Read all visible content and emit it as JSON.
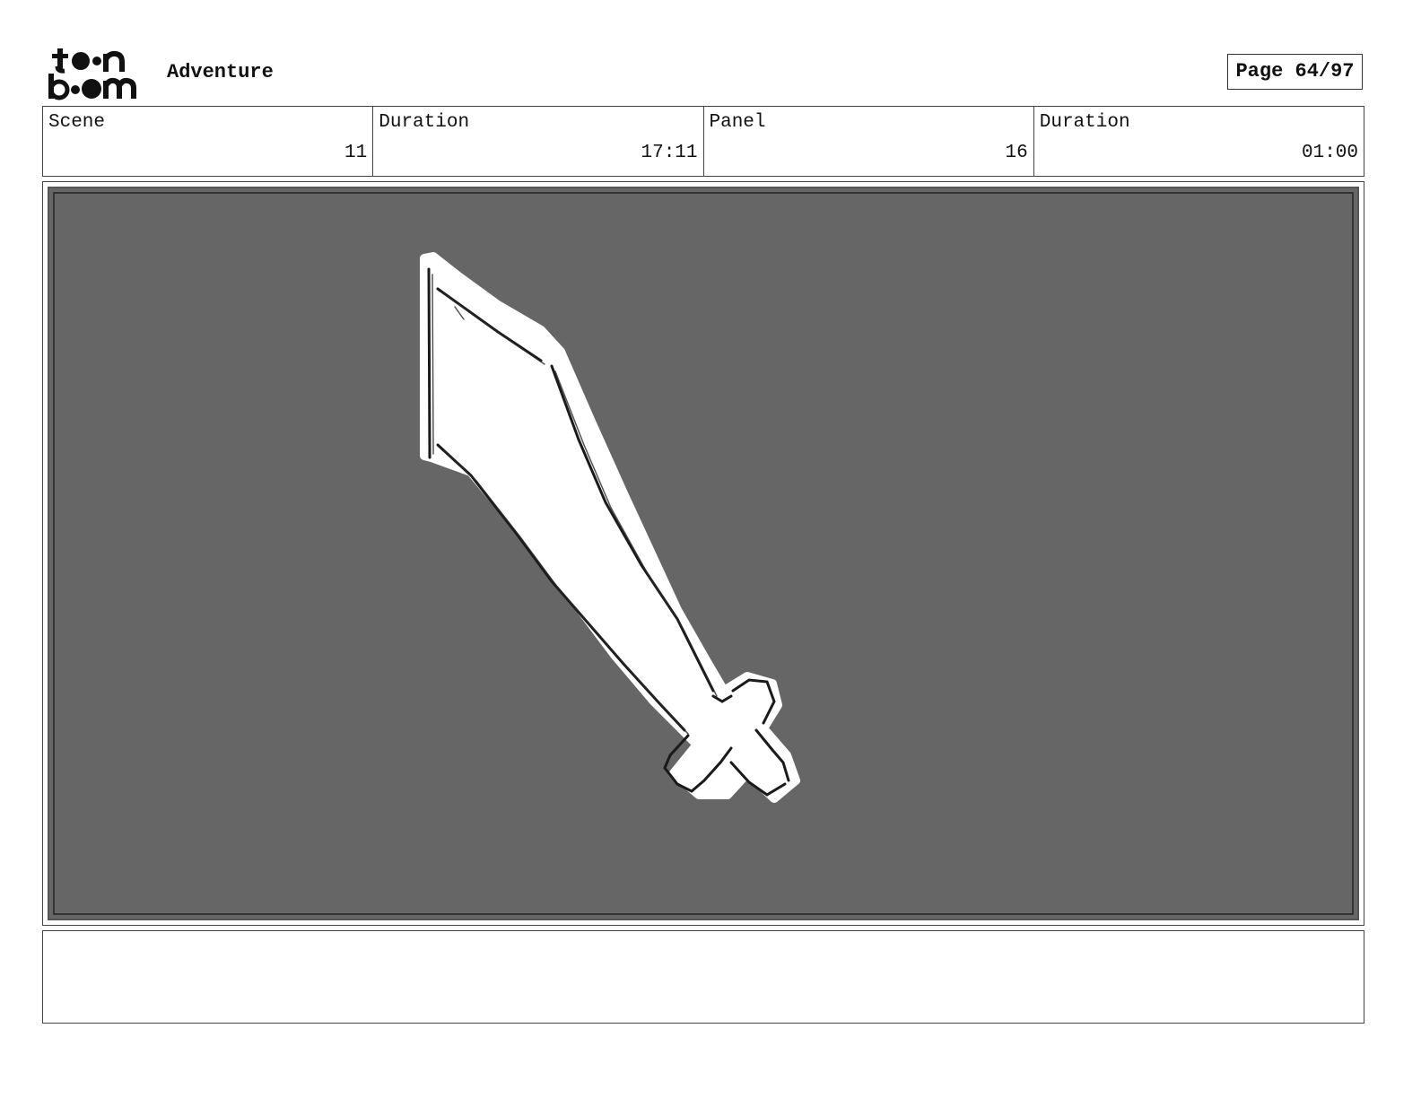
{
  "header": {
    "logo_line1": "toon",
    "logo_line2": "boom",
    "project_title": "Adventure",
    "page_label": "Page 64/97"
  },
  "info": [
    {
      "label": "Scene",
      "value": "11"
    },
    {
      "label": "Duration",
      "value": "17:11"
    },
    {
      "label": "Panel",
      "value": "16"
    },
    {
      "label": "Duration",
      "value": "01:00"
    }
  ],
  "panel": {
    "background_color": "#666666",
    "drawing": "sword-sketch-icon"
  },
  "notes": {
    "text": ""
  }
}
